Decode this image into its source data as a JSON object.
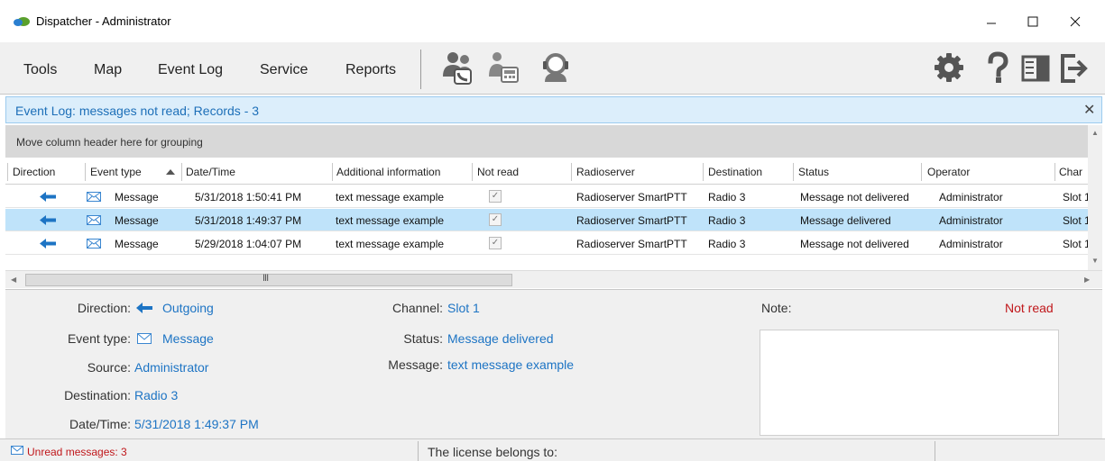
{
  "window": {
    "title": "Dispatcher - Administrator"
  },
  "menu": {
    "items": [
      "Tools",
      "Map",
      "Event Log",
      "Service",
      "Reports"
    ]
  },
  "toolbar_icons": [
    "calls-icon",
    "phone-directory-icon",
    "operator-headset-icon",
    "gear-icon",
    "help-icon",
    "layout-icon",
    "exit-icon"
  ],
  "event_log": {
    "title": "Event Log: messages not read; Records - 3",
    "group_hint": "Move column header here for grouping",
    "columns": [
      "Direction",
      "Event type",
      "Date/Time",
      "Additional information",
      "Not read",
      "Radioserver",
      "Destination",
      "Status",
      "Operator",
      "Char"
    ],
    "rows": [
      {
        "type": "Message",
        "datetime": "5/31/2018 1:50:41 PM",
        "info": "text message example",
        "not_read": true,
        "radioserver": "Radioserver SmartPTT",
        "destination": "Radio 3",
        "status": "Message not delivered",
        "operator": "Administrator",
        "channel": "Slot 1"
      },
      {
        "type": "Message",
        "datetime": "5/31/2018 1:49:37 PM",
        "info": "text message example",
        "not_read": true,
        "radioserver": "Radioserver SmartPTT",
        "destination": "Radio 3",
        "status": "Message delivered",
        "operator": "Administrator",
        "channel": "Slot 1"
      },
      {
        "type": "Message",
        "datetime": "5/29/2018 1:04:07 PM",
        "info": "text message example",
        "not_read": true,
        "radioserver": "Radioserver SmartPTT",
        "destination": "Radio 3",
        "status": "Message not delivered",
        "operator": "Administrator",
        "channel": "Slot 1"
      }
    ],
    "hscroll_grip": "III"
  },
  "details": {
    "direction_label": "Direction:",
    "direction": "Outgoing",
    "event_type_label": "Event type:",
    "event_type": "Message",
    "source_label": "Source:",
    "source": "Administrator",
    "destination_label": "Destination:",
    "destination": "Radio 3",
    "datetime_label": "Date/Time:",
    "datetime": "5/31/2018 1:49:37 PM",
    "channel_label": "Channel:",
    "channel": "Slot 1",
    "status_label": "Status:",
    "status": "Message delivered",
    "message_label": "Message:",
    "message": "text message example",
    "note_label": "Note:",
    "note_status": "Not read"
  },
  "statusbar": {
    "unread": "Unread messages: 3",
    "license": "The license belongs to:"
  },
  "colors": {
    "accent": "#1d74c4",
    "selected_row": "#bfe3fa",
    "alert": "#c0171b",
    "header_band": "#dceefb"
  }
}
